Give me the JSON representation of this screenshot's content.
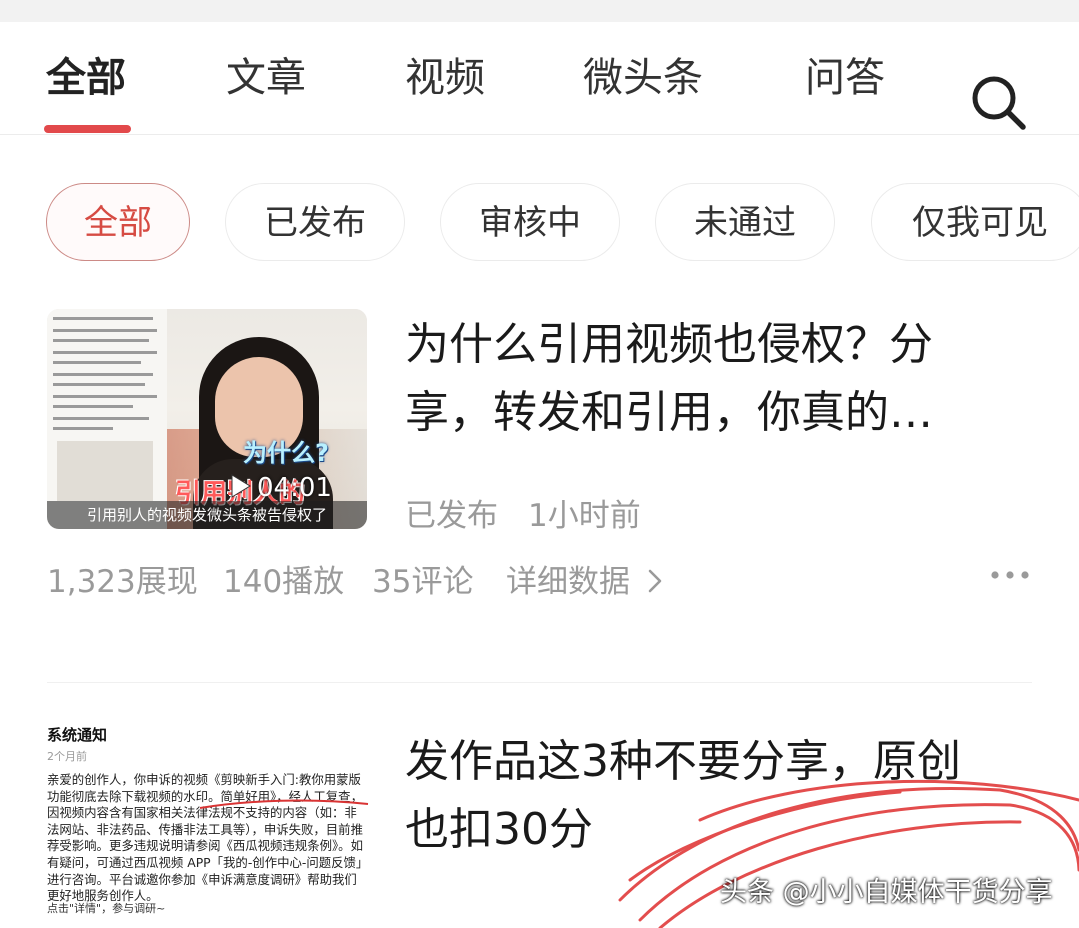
{
  "tabs": [
    {
      "label": "全部",
      "active": true
    },
    {
      "label": "文章",
      "active": false
    },
    {
      "label": "视频",
      "active": false
    },
    {
      "label": "微头条",
      "active": false
    },
    {
      "label": "问答",
      "active": false
    }
  ],
  "search_icon": "search-icon",
  "filters": [
    {
      "label": "全部",
      "active": true
    },
    {
      "label": "已发布",
      "active": false
    },
    {
      "label": "审核中",
      "active": false
    },
    {
      "label": "未通过",
      "active": false
    },
    {
      "label": "仅我可见",
      "active": false
    }
  ],
  "article1": {
    "title_line1": "为什么引用视频也侵权？分",
    "title_line2": "享，转发和引用，你真的…",
    "status": "已发布",
    "time": "1小时前",
    "thumb": {
      "caption_why": "为什么?",
      "caption_red": "引用别人的",
      "duration": "04:01",
      "subtitle": "引用别人的视频发微头条被告侵权了"
    },
    "stats": {
      "views": "1,323展现",
      "plays": "140播放",
      "comments": "35评论",
      "details": "详细数据",
      "details_arrow": "chevron-right-icon"
    },
    "more_icon": "more-dots-icon"
  },
  "article2": {
    "title_line1": "发作品这3种不要分享，原创",
    "title_line2": "也扣30分",
    "thumb": {
      "notice_title": "系统通知",
      "notice_time": "2个月前",
      "notice_body": "亲爱的创作人，你申诉的视频《剪映新手入门:教你用蒙版功能彻底去除下载视频的水印。简单好用》，经人工复查，因视频内容含有国家相关法律法规不支持的内容（如：非法网站、非法药品、传播非法工具等），申诉失败，目前推荐受影响。更多违规说明请参阅《西瓜视频违规条例》。如有疑问，可通过西瓜视频 APP「我的-创作中心-问题反馈」进行咨询。平台诚邀你参加《申诉满意度调研》帮助我们更好地服务创作人。",
      "notice_link": "点击\"详情\"，参与调研~"
    }
  },
  "watermark": "头条 @小小自媒体干货分享",
  "colors": {
    "accent": "#e2494b",
    "chip_active_text": "#d64b43",
    "meta": "#9a9a9a"
  }
}
